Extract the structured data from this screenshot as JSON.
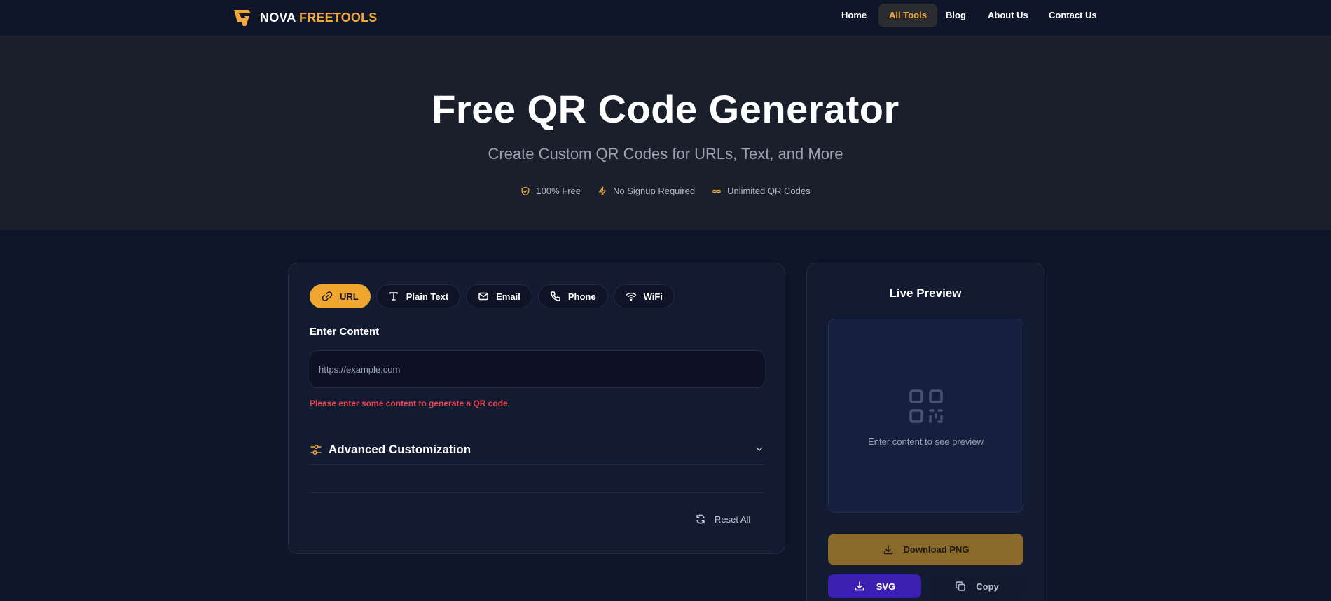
{
  "brand": {
    "name_white": "NOVA",
    "name_orange": "FREETOOLS",
    "logo_icon": "lightning-g-logo",
    "accent_color": "#f3a93a"
  },
  "nav": {
    "items": [
      {
        "label": "Home",
        "active": false
      },
      {
        "label": "All Tools",
        "active": true
      },
      {
        "label": "Blog",
        "active": false
      },
      {
        "label": "About Us",
        "active": false
      },
      {
        "label": "Contact Us",
        "active": false
      }
    ]
  },
  "hero": {
    "title": "Free QR Code Generator",
    "subtitle": "Create Custom QR Codes for URLs, Text, and More",
    "badges": [
      {
        "icon": "shield-check-icon",
        "label": "100% Free"
      },
      {
        "icon": "bolt-icon",
        "label": "No Signup Required"
      },
      {
        "icon": "infinity-icon",
        "label": "Unlimited QR Codes"
      }
    ]
  },
  "generator": {
    "tabs": [
      {
        "icon": "link-icon",
        "label": "URL",
        "active": true
      },
      {
        "icon": "text-t-icon",
        "label": "Plain Text",
        "active": false
      },
      {
        "icon": "mail-icon",
        "label": "Email",
        "active": false
      },
      {
        "icon": "phone-icon",
        "label": "Phone",
        "active": false
      },
      {
        "icon": "wifi-icon",
        "label": "WiFi",
        "active": false
      }
    ],
    "content_label": "Enter Content",
    "content_value": "",
    "content_placeholder": "https://example.com",
    "error_message": "Please enter some content to generate a QR code.",
    "advanced_title": "Advanced Customization",
    "reset_label": "Reset All"
  },
  "preview": {
    "title": "Live Preview",
    "hint": "Enter content to see preview",
    "download_png_label": "Download PNG",
    "svg_label": "SVG",
    "copy_label": "Copy"
  }
}
